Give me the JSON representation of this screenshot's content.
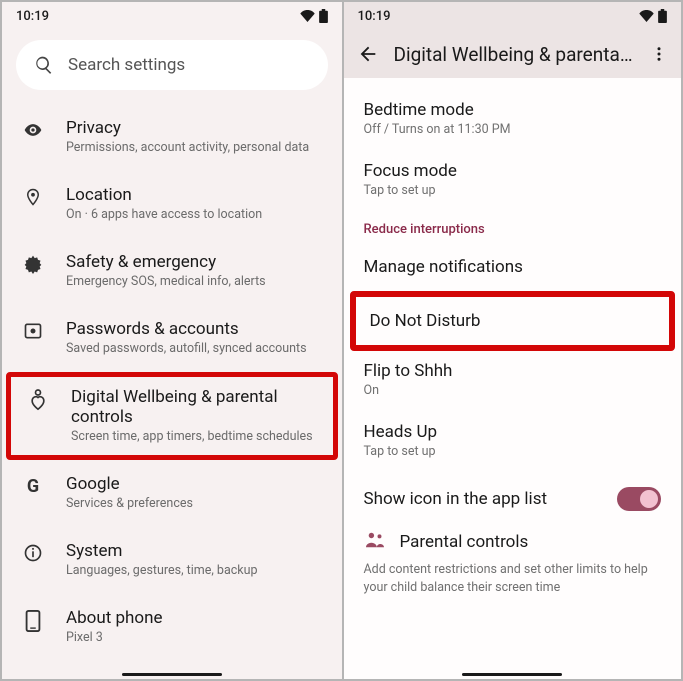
{
  "status": {
    "time": "10:19"
  },
  "left": {
    "search_placeholder": "Search settings",
    "items": [
      {
        "title": "Privacy",
        "sub": "Permissions, account activity, personal data"
      },
      {
        "title": "Location",
        "sub": "On · 6 apps have access to location"
      },
      {
        "title": "Safety & emergency",
        "sub": "Emergency SOS, medical info, alerts"
      },
      {
        "title": "Passwords & accounts",
        "sub": "Saved passwords, autofill, synced accounts"
      },
      {
        "title": "Digital Wellbeing & parental controls",
        "sub": "Screen time, app timers, bedtime schedules"
      },
      {
        "title": "Google",
        "sub": "Services & preferences"
      },
      {
        "title": "System",
        "sub": "Languages, gestures, time, backup"
      },
      {
        "title": "About phone",
        "sub": "Pixel 3"
      }
    ]
  },
  "right": {
    "appbar_title": "Digital Wellbeing & parental...",
    "bedtime": {
      "title": "Bedtime mode",
      "sub": "Off / Turns on at 11:30 PM"
    },
    "focus": {
      "title": "Focus mode",
      "sub": "Tap to set up"
    },
    "section": "Reduce interruptions",
    "manage_notifications": "Manage notifications",
    "dnd": "Do Not Disturb",
    "flip": {
      "title": "Flip to Shhh",
      "sub": "On"
    },
    "headsup": {
      "title": "Heads Up",
      "sub": "Tap to set up"
    },
    "show_icon": "Show icon in the app list",
    "parental": {
      "title": "Parental controls",
      "desc": "Add content restrictions and set other limits to help your child balance their screen time"
    }
  }
}
